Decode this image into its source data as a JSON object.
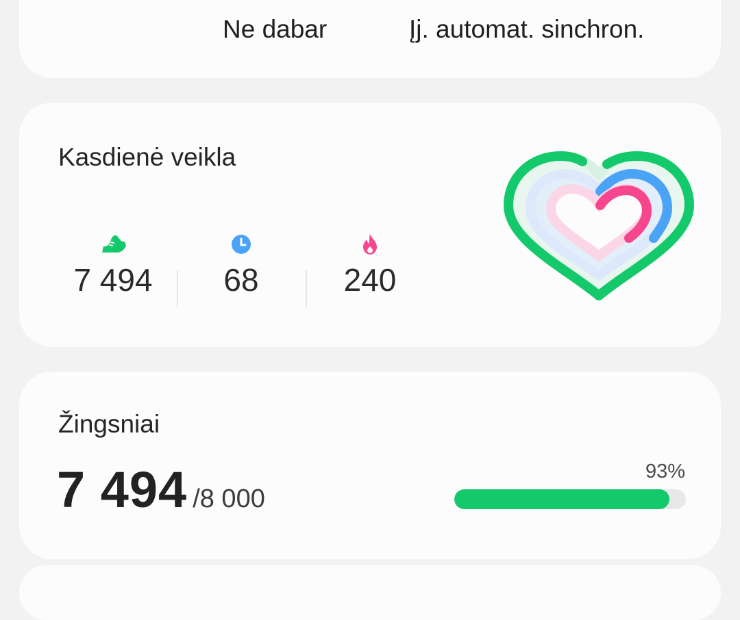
{
  "sync": {
    "not_now_label": "Ne dabar",
    "auto_sync_label": "Įj. automat. sinchron."
  },
  "daily_activity": {
    "title": "Kasdienė veikla",
    "steps": {
      "value": "7 494",
      "icon": "shoe-icon",
      "color": "#14c96b"
    },
    "active_minutes": {
      "value": "68",
      "icon": "clock-icon",
      "color": "#4aa3f5"
    },
    "calories": {
      "value": "240",
      "icon": "flame-icon",
      "color": "#f5468e"
    },
    "heart_rings": {
      "icon": "activity-heart-icon",
      "steps_progress": 0.93,
      "minutes_progress": 0.75,
      "calories_progress": 0.5
    }
  },
  "steps_card": {
    "title": "Žingsniai",
    "count": "7 494",
    "goal": "/8 000",
    "percent_label": "93%",
    "progress": 0.93,
    "bar_color": "#14c96b"
  }
}
